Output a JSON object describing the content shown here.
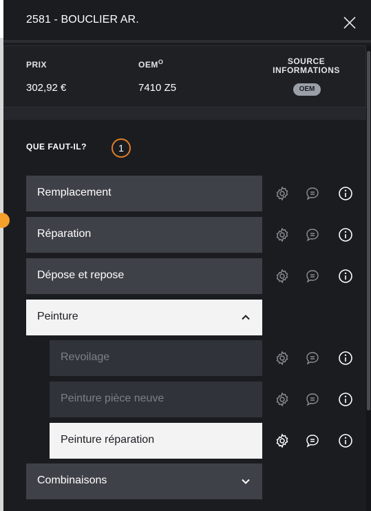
{
  "header": {
    "title": "2581 - BOUCLIER AR."
  },
  "info": {
    "price_label": "PRIX",
    "price_value": "302,92 €",
    "oem_label": "OEM",
    "oem_sup": "O",
    "oem_value": "7410 Z5",
    "source_label": "SOURCE INFORMATIONS",
    "source_badge": "OEM"
  },
  "section": {
    "label": "QUE FAUT-IL?",
    "count": "1"
  },
  "operations": [
    {
      "label": "Remplacement"
    },
    {
      "label": "Réparation"
    },
    {
      "label": "Dépose et repose"
    },
    {
      "label": "Peinture",
      "expanded": true
    },
    {
      "label": "Combinaisons",
      "expanded": false
    }
  ],
  "peinture_items": [
    {
      "label": "Revoilage",
      "enabled": false
    },
    {
      "label": "Peinture pièce neuve",
      "enabled": false
    },
    {
      "label": "Peinture réparation",
      "selected": true
    }
  ],
  "colors": {
    "accent": "#f5a02a",
    "badge_ring": "#e07e2a",
    "row_bg": "#3f4148",
    "sub_row_bg": "#31333a",
    "selected_bg": "#f3f3f4",
    "panel_bg": "#1b1c20"
  },
  "icons": [
    "close-icon",
    "gear-icon",
    "comment-icon",
    "info-icon",
    "chevron-up-icon",
    "chevron-down-icon"
  ]
}
